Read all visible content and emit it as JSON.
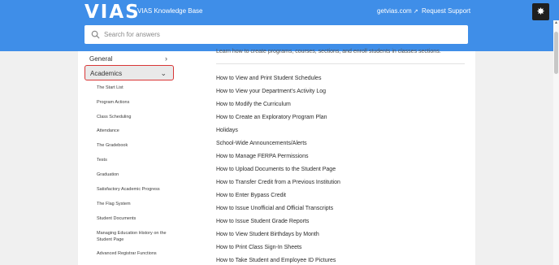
{
  "header": {
    "logo": "VIAS",
    "kb_title": "VIAS Knowledge Base",
    "nav": [
      {
        "label": "getvias.com",
        "icon": "external-link-icon"
      },
      {
        "label": "Request Support"
      }
    ],
    "badge_icon": "hubspot-icon"
  },
  "search": {
    "placeholder": "Search for answers",
    "icon": "search-icon"
  },
  "sidebar": {
    "categories": [
      {
        "label": "General",
        "icon": "chevron-right-icon"
      },
      {
        "label": "Academics",
        "icon": "chevron-down-icon",
        "expanded": true
      }
    ],
    "subitems": [
      "The Start List",
      "Program Actions",
      "Class Scheduling",
      "Attendance",
      "The Gradebook",
      "Tests",
      "Graduation",
      "Satisfactory Academic Progress",
      "The Flag System",
      "Student Documents",
      "Managing Education History on the Student Page",
      "Advanced Registrar Functions"
    ]
  },
  "main": {
    "intro": "Learn how to create programs, courses, sections, and enroll students in classes sections.",
    "articles": [
      "How to View and Print Student Schedules",
      "How to View your Department's Activity Log",
      "How to Modify the Curriculum",
      "How to Create an Exploratory Program Plan",
      "Holidays",
      "School-Wide Announcements/Alerts",
      "How to Manage FERPA Permissions",
      "How to Upload Documents to the Student Page",
      "How to Transfer Credit from a Previous Institution",
      "How to Enter Bypass Credit",
      "How to Issue Unofficial and Official Transcripts",
      "How to Issue Student Grade Reports",
      "How to View Student Birthdays by Month",
      "How to Print Class Sign-In Sheets",
      "How to Take Student and Employee ID Pictures"
    ]
  },
  "colors": {
    "header_bg": "#3f8ee8",
    "highlight_border": "#d93636"
  }
}
